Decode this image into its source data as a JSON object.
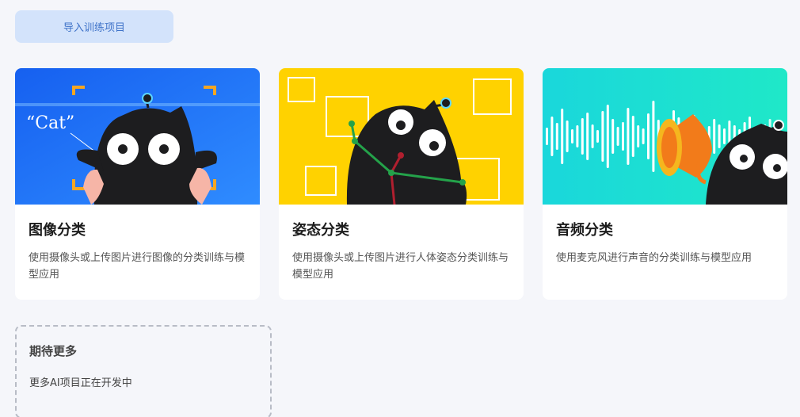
{
  "toolbar": {
    "import_label": "导入训练项目"
  },
  "cards": [
    {
      "title": "图像分类",
      "desc": "使用摄像头或上传图片进行图像的分类训练与模型应用",
      "banner_text": "“Cat”",
      "banner_color": "#1b6ff5"
    },
    {
      "title": "姿态分类",
      "desc": "使用摄像头或上传图片进行人体姿态分类训练与模型应用",
      "banner_color": "#ffd200"
    },
    {
      "title": "音频分类",
      "desc": "使用麦克风进行声音的分类训练与模型应用",
      "banner_color": "#1ad7db"
    }
  ],
  "coming_soon": {
    "title": "期待更多",
    "desc": "更多AI项目正在开发中"
  },
  "colors": {
    "accent": "#3f73c9",
    "button_bg": "#d3e3fb",
    "page_bg": "#f5f6fa"
  }
}
